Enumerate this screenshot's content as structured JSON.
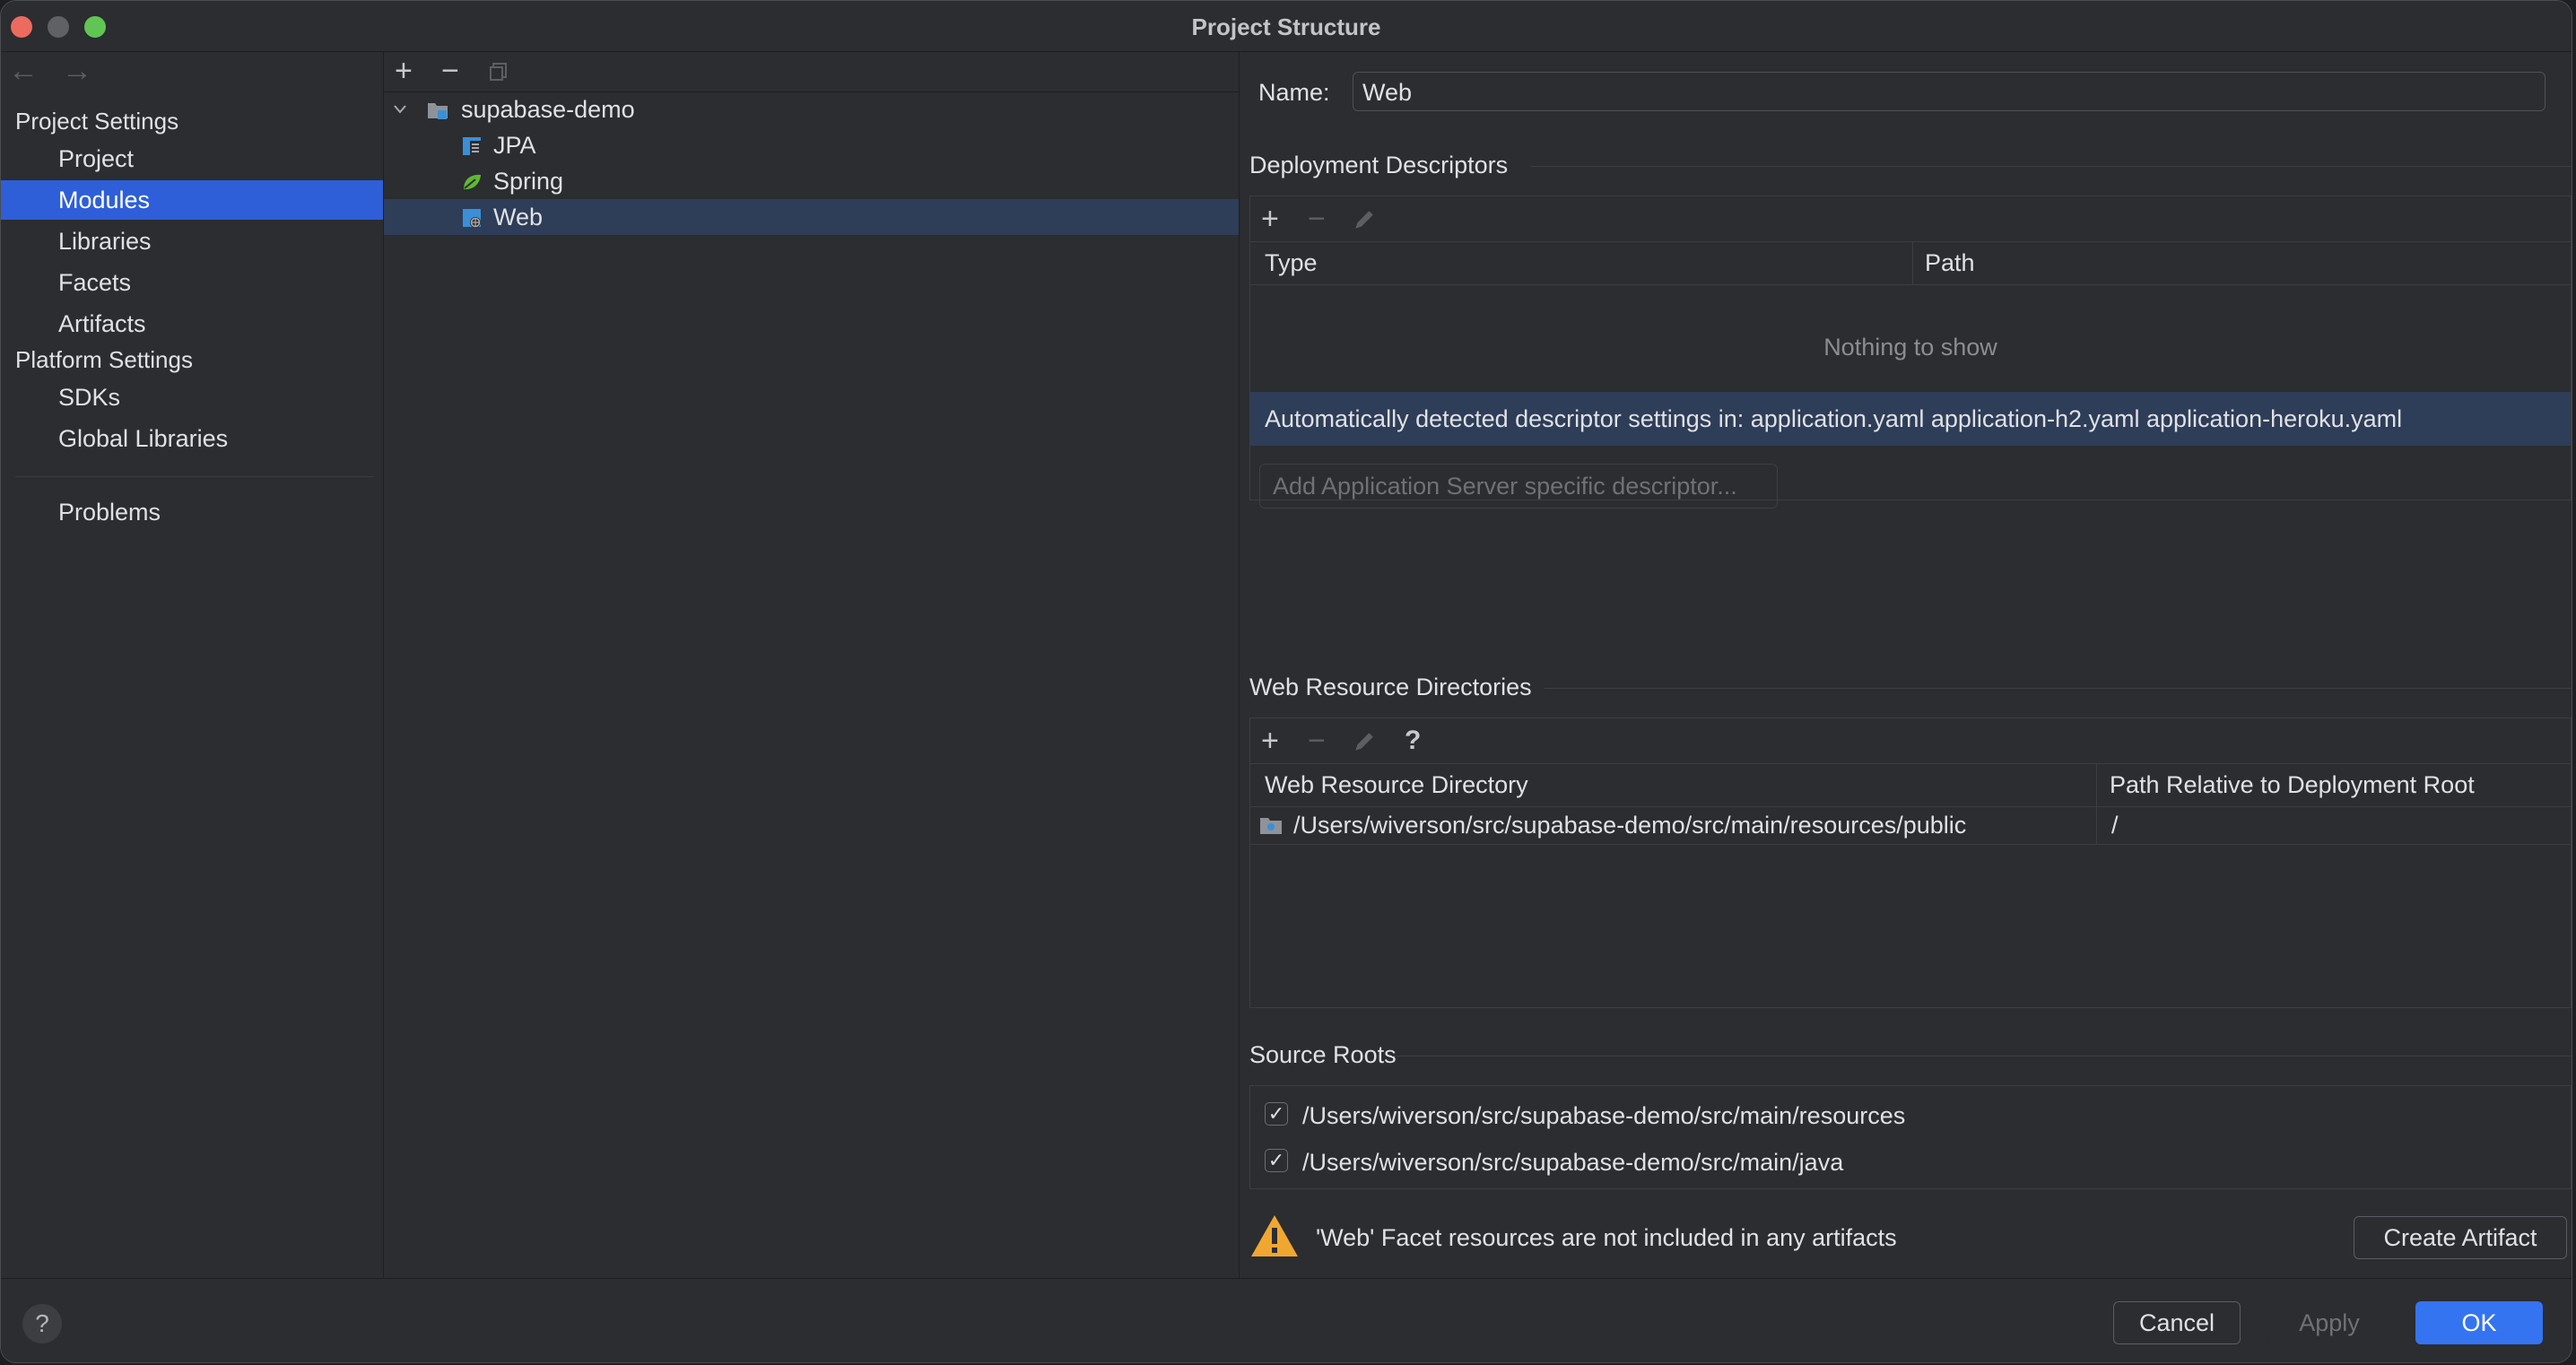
{
  "window": {
    "title": "Project Structure"
  },
  "sidebar": {
    "back_arrow": "←",
    "forward_arrow": "→",
    "project_settings_header": "Project Settings",
    "project_items": [
      {
        "label": "Project"
      },
      {
        "label": "Modules",
        "selected": true
      },
      {
        "label": "Libraries"
      },
      {
        "label": "Facets"
      },
      {
        "label": "Artifacts"
      }
    ],
    "platform_settings_header": "Platform Settings",
    "platform_items": [
      {
        "label": "SDKs"
      },
      {
        "label": "Global Libraries"
      }
    ],
    "problems_label": "Problems"
  },
  "tree": {
    "toolbar": {
      "add": "+",
      "remove": "−"
    },
    "root": {
      "label": "supabase-demo",
      "expanded": true
    },
    "children": [
      {
        "label": "JPA",
        "icon": "jpa-icon"
      },
      {
        "label": "Spring",
        "icon": "spring-leaf-icon"
      },
      {
        "label": "Web",
        "icon": "web-facet-icon",
        "selected": true
      }
    ]
  },
  "panel": {
    "name_label": "Name:",
    "name_value": "Web",
    "deployment": {
      "title": "Deployment Descriptors",
      "toolbar": {
        "add": "+",
        "remove": "−"
      },
      "columns": [
        "Type",
        "Path"
      ],
      "empty_text": "Nothing to show",
      "auto_detected": "Automatically detected descriptor settings in: application.yaml application-h2.yaml application-heroku.yaml",
      "add_server_button": "Add Application Server specific descriptor..."
    },
    "web_resources": {
      "title": "Web Resource Directories",
      "toolbar": {
        "add": "+",
        "remove": "−",
        "help": "?"
      },
      "columns": [
        "Web Resource Directory",
        "Path Relative to Deployment Root"
      ],
      "rows": [
        {
          "directory": "/Users/wiverson/src/supabase-demo/src/main/resources/public",
          "relative_path": "/"
        }
      ]
    },
    "source_roots": {
      "title": "Source Roots",
      "items": [
        {
          "path": "/Users/wiverson/src/supabase-demo/src/main/resources",
          "checked": true,
          "mark": "✓"
        },
        {
          "path": "/Users/wiverson/src/supabase-demo/src/main/java",
          "checked": true,
          "mark": "✓"
        }
      ]
    },
    "warning": {
      "text": "'Web' Facet resources are not included in any artifacts",
      "create_artifact_button": "Create Artifact"
    }
  },
  "footer": {
    "help": "?",
    "cancel": "Cancel",
    "apply": "Apply",
    "ok": "OK"
  },
  "colors": {
    "selection": "#2e5fd8",
    "row_highlight": "#2e3d58",
    "primary_button": "#3574f0",
    "close": "#ed6a5e",
    "maximize": "#61c554",
    "warning": "#f0a732"
  }
}
